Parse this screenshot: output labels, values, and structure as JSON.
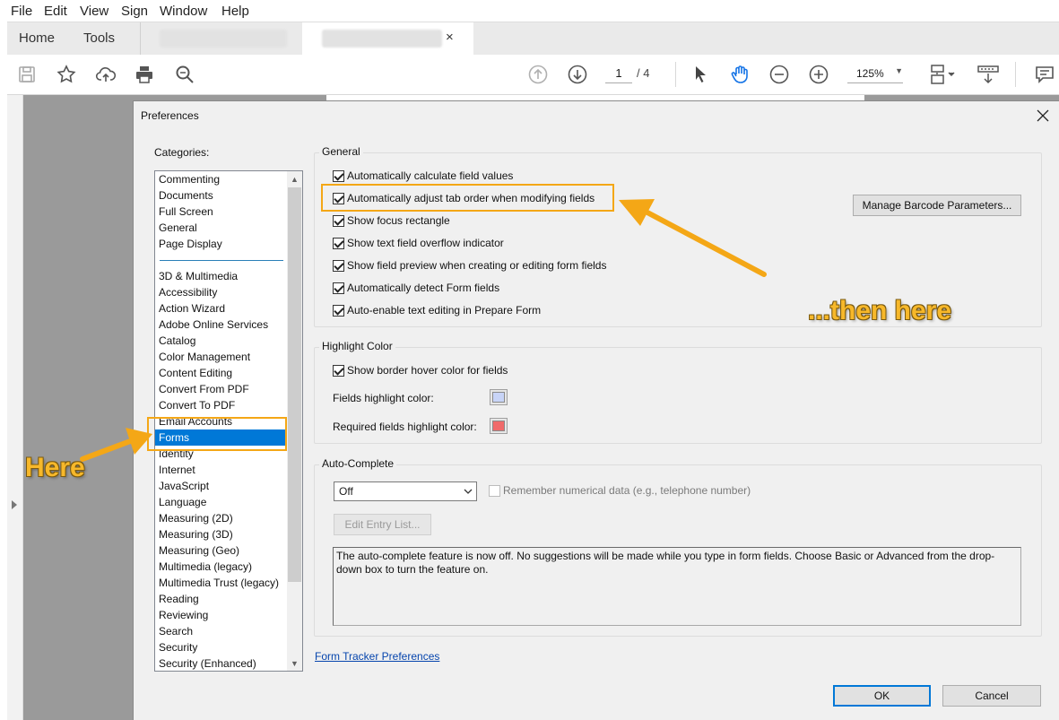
{
  "menubar": {
    "items": [
      "File",
      "Edit",
      "View",
      "Sign",
      "Window",
      "Help"
    ]
  },
  "tabs": {
    "home": "Home",
    "tools": "Tools",
    "close": "×"
  },
  "toolbar": {
    "page_current": "1",
    "page_total": "/ 4",
    "zoom": "125%"
  },
  "dialog": {
    "title": "Preferences",
    "categories_label": "Categories:",
    "categories_top": [
      "Commenting",
      "Documents",
      "Full Screen",
      "General",
      "Page Display"
    ],
    "categories": [
      "3D & Multimedia",
      "Accessibility",
      "Action Wizard",
      "Adobe Online Services",
      "Catalog",
      "Color Management",
      "Content Editing",
      "Convert From PDF",
      "Convert To PDF",
      "Email Accounts",
      "Forms",
      "Identity",
      "Internet",
      "JavaScript",
      "Language",
      "Measuring (2D)",
      "Measuring (3D)",
      "Measuring (Geo)",
      "Multimedia (legacy)",
      "Multimedia Trust (legacy)",
      "Reading",
      "Reviewing",
      "Search",
      "Security",
      "Security (Enhanced)"
    ],
    "selected_category": "Forms",
    "general": {
      "title": "General",
      "options": [
        {
          "label": "Automatically calculate field values",
          "checked": true
        },
        {
          "label": "Automatically adjust tab order when modifying fields",
          "checked": true
        },
        {
          "label": "Show focus rectangle",
          "checked": true
        },
        {
          "label": "Show text field overflow indicator",
          "checked": true
        },
        {
          "label": "Show field preview when creating or editing form fields",
          "checked": true
        },
        {
          "label": "Automatically detect Form fields",
          "checked": true
        },
        {
          "label": "Auto-enable text editing in Prepare Form",
          "checked": true
        }
      ],
      "barcode_button": "Manage Barcode Parameters..."
    },
    "highlight": {
      "title": "Highlight Color",
      "show_border_hover": "Show border hover color for fields",
      "fields_color_label": "Fields highlight color:",
      "fields_color": "#c8d4f7",
      "required_color_label": "Required fields highlight color:",
      "required_color": "#f06a6a"
    },
    "autocomplete": {
      "title": "Auto-Complete",
      "mode": "Off",
      "remember_numerical": "Remember numerical data (e.g., telephone number)",
      "edit_entry_button": "Edit Entry List...",
      "description": "The auto-complete feature is now off. No suggestions will be made while you type in form fields. Choose Basic or Advanced from the drop-down box to turn the feature on."
    },
    "form_tracker_link": "Form Tracker Preferences",
    "ok": "OK",
    "cancel": "Cancel"
  },
  "annotations": {
    "here": "Here",
    "then_here": "...then here",
    "color": "#f4a716"
  }
}
